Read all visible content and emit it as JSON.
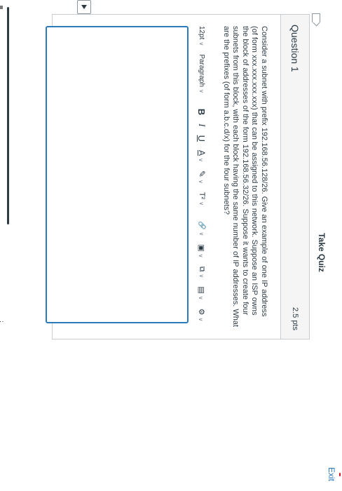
{
  "header": {
    "title": "Take Quiz",
    "exit_label": "Exit"
  },
  "question": {
    "title": "Question 1",
    "points": "2.5 pts",
    "text": "Consider a subnet with prefix 192.168.56.128/26. Give an example of one IP address (of form xxx.xxx.xxx.xxx) that can be assigned to this network. Suppose an ISP owns the block of addresses of the form 192.168.56.32/26. Suppose it wants to create four subnets from this block, with each block having the same number of IP addresses. What are the prefixes (of form a.b.c.d/x) for the four subnets?"
  },
  "toolbar": {
    "font_size": "12pt",
    "paragraph": "Paragraph",
    "bold": "B",
    "italic": "I",
    "underline": "U",
    "text_color": "A",
    "highlight": "✎",
    "superscript": "T²",
    "link": "🔗",
    "image": "▣",
    "media": "⧉",
    "document": "▤",
    "tools": "⚙",
    "chevron": "∨"
  },
  "icons": {
    "flag": "flag-icon",
    "dropdown": "dropdown-arrow-icon"
  },
  "colors": {
    "accent": "#2b7abc",
    "text": "#2d3b45",
    "border": "#c7cdd1"
  }
}
